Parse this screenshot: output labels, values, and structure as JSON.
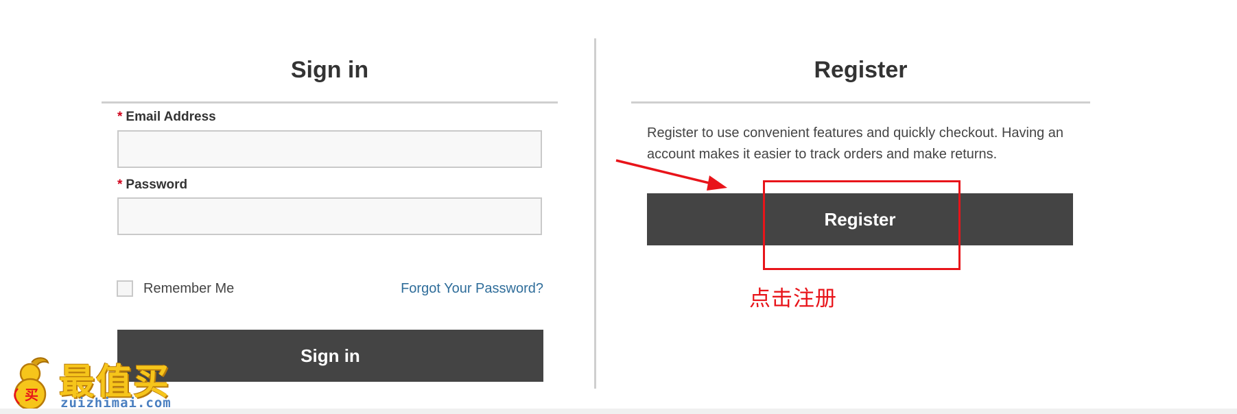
{
  "signin": {
    "title": "Sign in",
    "email_label": "Email Address",
    "email_value": "",
    "password_label": "Password",
    "password_value": "",
    "required_marker": "*",
    "remember_label": "Remember Me",
    "remember_checked": false,
    "forgot_label": "Forgot Your Password?",
    "button_label": "Sign in"
  },
  "register": {
    "title": "Register",
    "description": "Register to use convenient features and quickly checkout. Having an account makes it easier to track orders and make returns.",
    "button_label": "Register"
  },
  "annotation": {
    "text": "点击注册",
    "color": "#e8141a"
  },
  "watermark": {
    "chars": "最值买",
    "url": "zuizhimai.com",
    "gourd_char": "买"
  },
  "colors": {
    "button_bg": "#444444",
    "link": "#2f6d9a",
    "required": "#d0021b",
    "divider": "#cfcfcf"
  }
}
